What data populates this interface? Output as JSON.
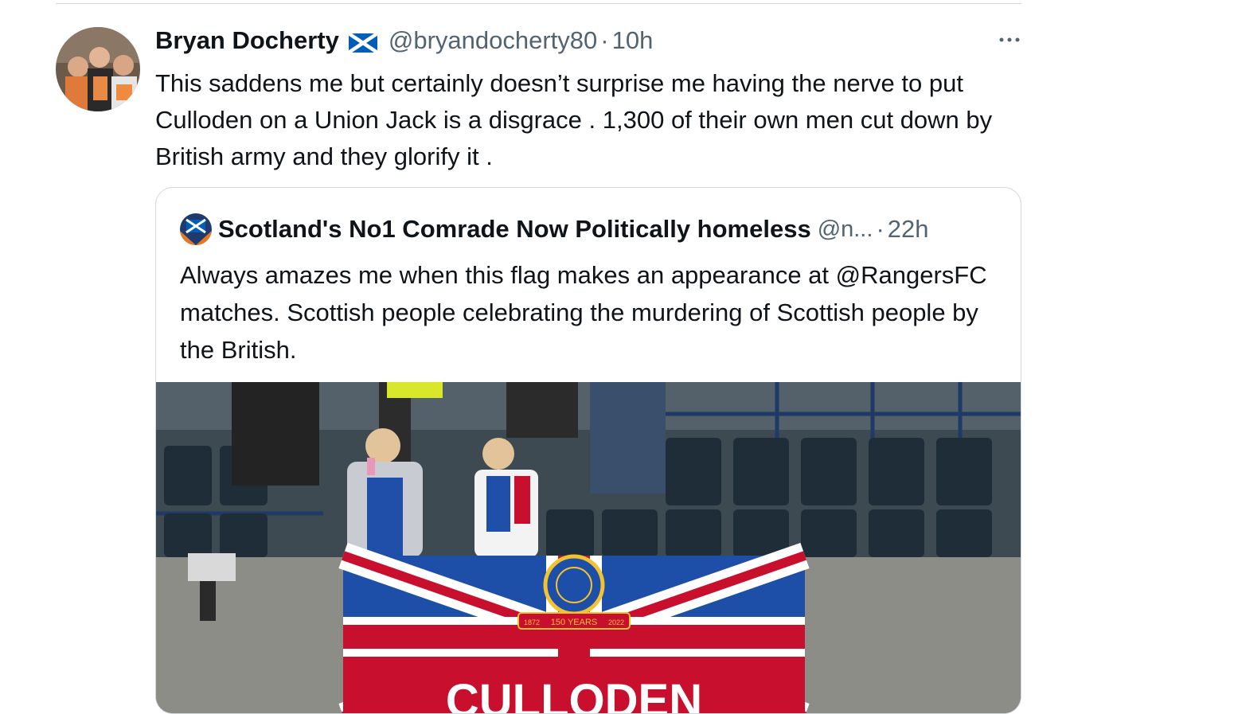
{
  "tweet": {
    "display_name": "Bryan Docherty",
    "flag_icon": "scotland-flag-icon",
    "handle": "@bryandocherty80",
    "separator": "·",
    "time": "10h",
    "more_icon": "more-horizontal-icon",
    "text": "This saddens me but certainly doesn’t surprise me having the nerve to put Culloden on a Union Jack is a disgrace . 1,300 of their own men cut down by British army and they glorify it ."
  },
  "quote": {
    "display_name": "Scotland's No1 Comrade Now Politically homeless",
    "handle": "@n...",
    "separator": "·",
    "time": "22h",
    "text": "Always amazes me when this flag makes an appearance at @RangersFC matches. Scottish people celebrating the murdering of Scottish people by the British.",
    "media": {
      "banner_text": "CULLODEN",
      "crest_years_label": "150 YEARS",
      "crest_year_left": "1872",
      "crest_year_right": "2022"
    }
  },
  "colors": {
    "text_primary": "#0f1419",
    "text_secondary": "#536471",
    "border": "#cfd9de",
    "union_red": "#c8102e",
    "union_blue": "#1e4fa8"
  }
}
